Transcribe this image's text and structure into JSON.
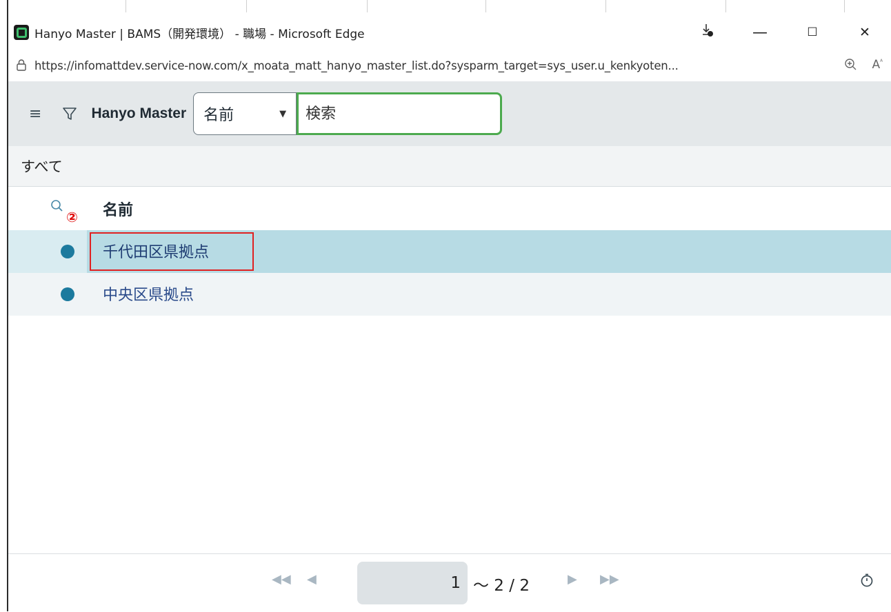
{
  "window": {
    "title": "Hanyo Master | BAMS（開発環境） - 職場 - Microsoft Edge",
    "minimize": "—",
    "maximize": "☐",
    "close": "✕"
  },
  "addressbar": {
    "url": "https://infomattdev.service-now.com/x_moata_matt_hanyo_master_list.do?sysparm_target=sys_user.u_kenkyoten..."
  },
  "header": {
    "list_title": "Hanyo Master",
    "field_select_value": "名前",
    "search_placeholder": "検索"
  },
  "breadcrumb": {
    "label": "すべて"
  },
  "list": {
    "column_header": "名前",
    "annotation_marker": "②",
    "rows": [
      {
        "label": "千代田区県拠点",
        "selected": true
      },
      {
        "label": "中央区県拠点",
        "selected": false
      }
    ]
  },
  "pagination": {
    "current_page": "1",
    "range_text": "～ 2 / 2"
  },
  "colors": {
    "header_bg": "#e4e8ea",
    "selected_row_bg": "#b7dbe4",
    "search_border": "#4caa4e",
    "highlight_box": "#e02020",
    "link_text": "#2a4a8a"
  }
}
